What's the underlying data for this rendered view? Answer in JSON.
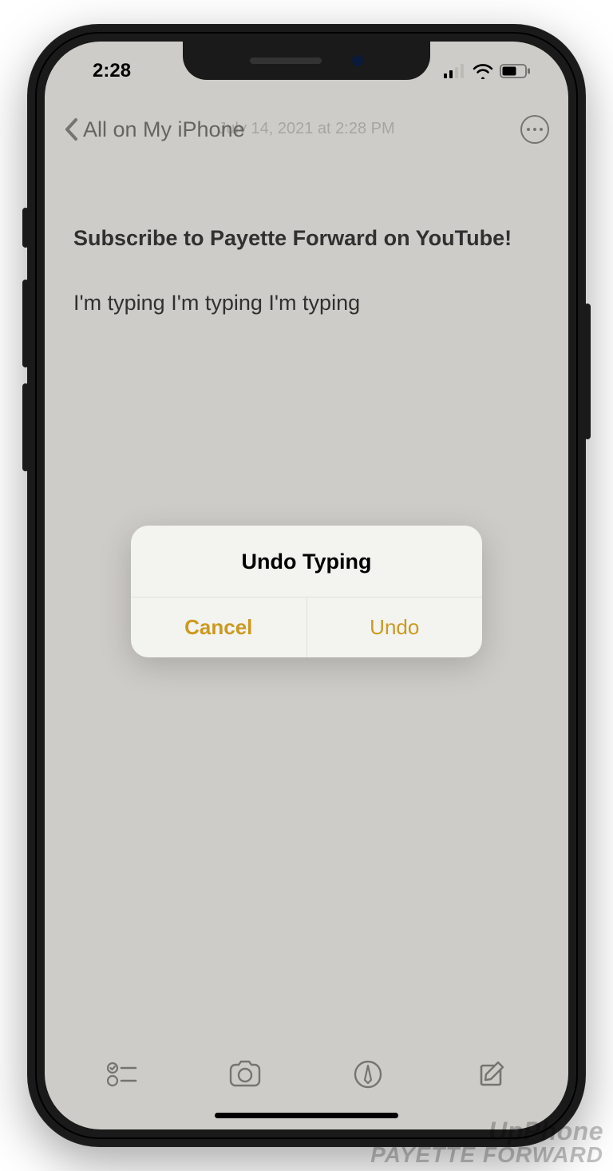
{
  "status": {
    "time": "2:28"
  },
  "nav": {
    "back_label": "All on My iPhone",
    "date_label": "July 14, 2021 at 2:28 PM"
  },
  "note": {
    "title": "Subscribe to Payette Forward on YouTube!",
    "body": "I'm typing I'm typing I'm typing"
  },
  "alert": {
    "title": "Undo Typing",
    "cancel_label": "Cancel",
    "confirm_label": "Undo"
  },
  "watermark": {
    "line1": "UpPhone",
    "line2": "Payette Forward"
  }
}
